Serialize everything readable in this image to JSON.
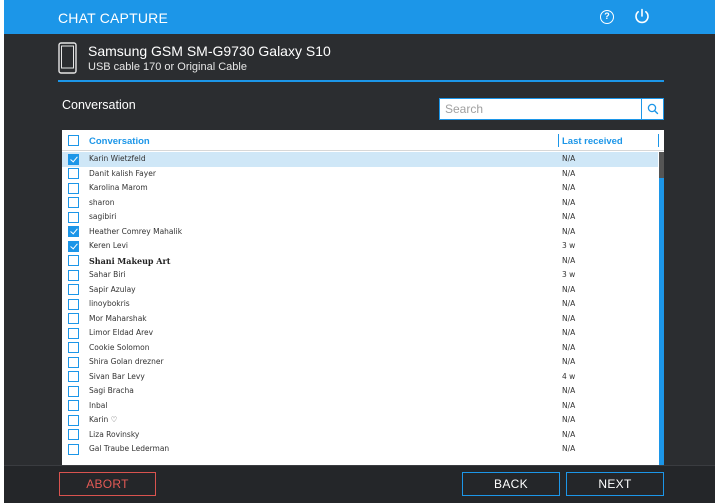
{
  "app": {
    "title": "CHAT CAPTURE"
  },
  "device": {
    "name": "Samsung GSM SM-G9730 Galaxy S10",
    "connection": "USB cable 170 or Original Cable"
  },
  "section": {
    "label": "Conversation"
  },
  "search": {
    "placeholder": "Search",
    "value": ""
  },
  "table": {
    "columns": {
      "conversation": "Conversation",
      "last_received": "Last received"
    },
    "rows": [
      {
        "name": "Karin Wietzfeld",
        "last": "N/A",
        "checked": true,
        "selected": true
      },
      {
        "name": "Danit kalish Fayer",
        "last": "N/A",
        "checked": false
      },
      {
        "name": "Karolina Marom",
        "last": "N/A",
        "checked": false
      },
      {
        "name": "sharon",
        "last": "N/A",
        "checked": false
      },
      {
        "name": "sagibiri",
        "last": "N/A",
        "checked": false
      },
      {
        "name": "Heather Comrey Mahalik",
        "last": "N/A",
        "checked": true
      },
      {
        "name": "Keren Levi",
        "last": "3 w",
        "checked": true
      },
      {
        "name": "Shani Makeup Art",
        "last": "N/A",
        "checked": false,
        "bold": true
      },
      {
        "name": "Sahar Biri",
        "last": "3 w",
        "checked": false
      },
      {
        "name": "Sapir Azulay",
        "last": "N/A",
        "checked": false
      },
      {
        "name": "linoybokris",
        "last": "N/A",
        "checked": false
      },
      {
        "name": "Mor Maharshak",
        "last": "N/A",
        "checked": false
      },
      {
        "name": "Limor Eldad Arev",
        "last": "N/A",
        "checked": false
      },
      {
        "name": "Cookie Solomon",
        "last": "N/A",
        "checked": false
      },
      {
        "name": "Shira Golan drezner",
        "last": "N/A",
        "checked": false
      },
      {
        "name": "Sivan Bar Levy",
        "last": "4 w",
        "checked": false
      },
      {
        "name": "Sagi Bracha",
        "last": "N/A",
        "checked": false
      },
      {
        "name": "Inbal",
        "last": "N/A",
        "checked": false
      },
      {
        "name": "Karin ♡",
        "last": "N/A",
        "checked": false
      },
      {
        "name": "Liza Rovinsky",
        "last": "N/A",
        "checked": false
      },
      {
        "name": "Gal Traube Lederman",
        "last": "N/A",
        "checked": false
      }
    ]
  },
  "footer": {
    "abort": "ABORT",
    "back": "BACK",
    "next": "NEXT"
  },
  "colors": {
    "accent": "#1c96e8",
    "background": "#2b2d30",
    "abort": "#d9534f",
    "selected_row": "#cfe7f7"
  },
  "icons": {
    "help": "help-icon",
    "power": "power-icon",
    "device": "phone-icon",
    "search": "search-icon"
  }
}
